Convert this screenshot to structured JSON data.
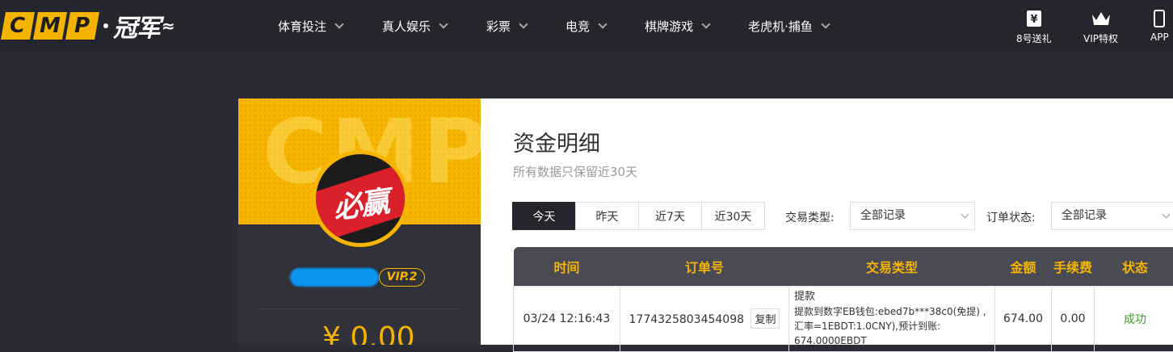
{
  "logo": {
    "letters": [
      "C",
      "M",
      "P"
    ],
    "cn": "冠军",
    "tail": "≈"
  },
  "nav": [
    {
      "label": "体育投注"
    },
    {
      "label": "真人娱乐"
    },
    {
      "label": "彩票"
    },
    {
      "label": "电竞"
    },
    {
      "label": "棋牌游戏"
    },
    {
      "label": "老虎机·捕鱼"
    }
  ],
  "header_right": {
    "gift": {
      "label": "8号送礼",
      "icon": "gift-icon"
    },
    "vip": {
      "label": "VIP特权",
      "icon": "crown-icon"
    },
    "app": {
      "label": "APP",
      "icon": "phone-icon"
    }
  },
  "profile": {
    "watermark": "CMP",
    "avatar_text": "必赢",
    "vip_level": "VIP.2",
    "balance": "¥ 0.00"
  },
  "main": {
    "title": "资金明细",
    "subtitle": "所有数据只保留近30天",
    "date_tabs": [
      "今天",
      "昨天",
      "近7天",
      "近30天"
    ],
    "active_tab": "今天",
    "filter_type_label": "交易类型:",
    "filter_type_value": "全部记录",
    "filter_status_label": "订单状态:",
    "filter_status_value": "全部记录"
  },
  "table": {
    "headers": [
      "时间",
      "订单号",
      "交易类型",
      "金额",
      "手续费",
      "状态"
    ],
    "rows": [
      {
        "time": "03/24 12:16:43",
        "order_no": "1774325803454098",
        "copy_label": "复制",
        "type_title": "提款",
        "type_detail": "提款到数字EB钱包:ebed7b***38c0(免提) ,汇率=1EBDT:1.0CNY),预计到账: 674.0000EBDT",
        "amount": "674.00",
        "fee": "0.00",
        "status": "成功"
      }
    ]
  },
  "colors": {
    "accent": "#f5b400",
    "header_bg": "#25252e",
    "success": "#3a9d23"
  }
}
